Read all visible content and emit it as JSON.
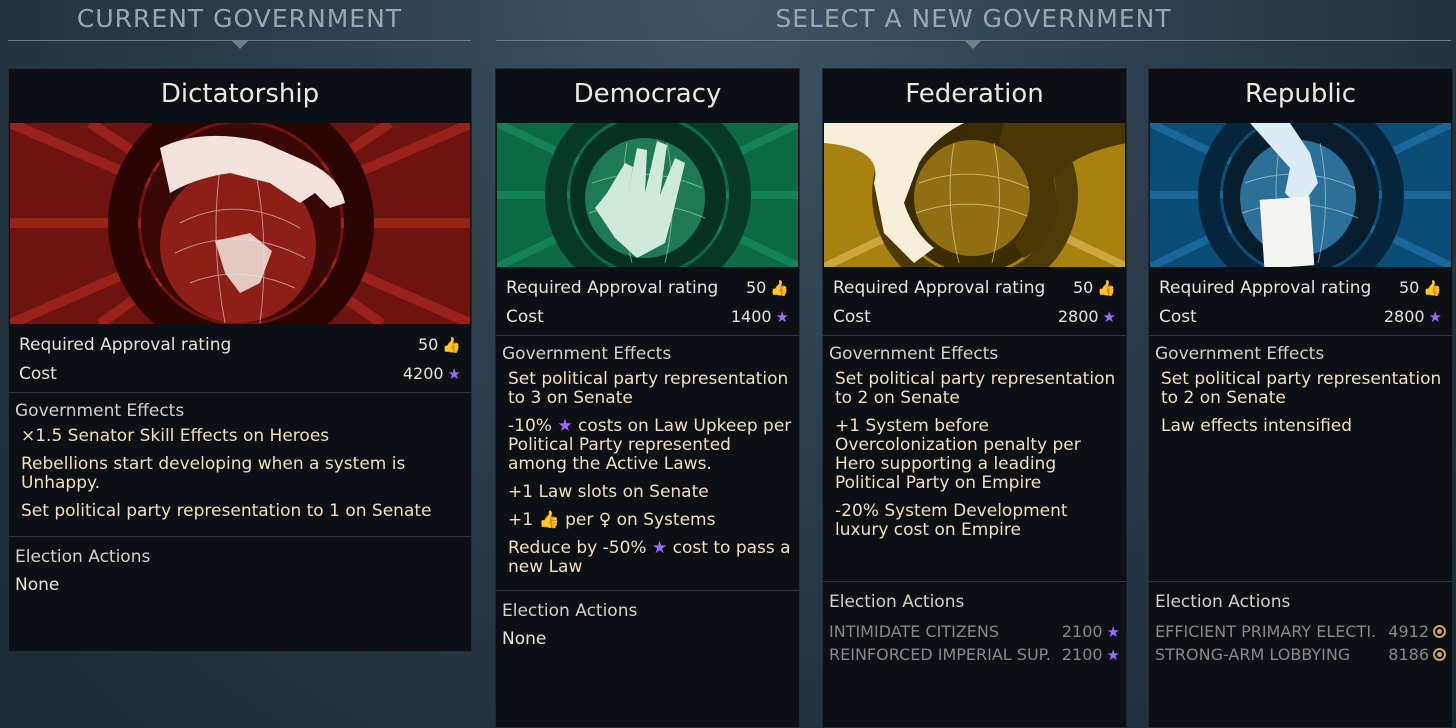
{
  "headers": {
    "current": "CURRENT GOVERNMENT",
    "select": "SELECT A NEW GOVERNMENT"
  },
  "colors": {
    "approval_icon": "#f06ec2",
    "influence_star": "#9b6cff",
    "red_underline": "#d81c1c",
    "effect_text": "#f1dfbf"
  },
  "cards": [
    {
      "name": "Dictatorship",
      "theme": "red",
      "approval_label": "Required Approval rating",
      "approval_value": "50",
      "cost_label": "Cost",
      "cost_value": "4200",
      "effects_label": "Government Effects",
      "effects": [
        "×1.5 Senator Skill Effects on Heroes",
        "Rebellions start developing when a system is Unhappy.",
        "Set political party representation to 1 on Senate"
      ],
      "actions_label": "Election Actions",
      "actions_none": "None"
    },
    {
      "name": "Democracy",
      "theme": "green",
      "approval_label": "Required Approval rating",
      "approval_value": "50",
      "cost_label": "Cost",
      "cost_value": "1400",
      "effects_label": "Government Effects",
      "effects": [
        "Set political party representation to 3 on Senate",
        "-10% ★ costs on Law Upkeep per Political Party represented among the Active Laws.",
        "+1 Law slots on Senate",
        "+1 👍 per ♀ on Systems",
        "Reduce by -50% ★ cost to pass a new Law"
      ],
      "actions_label": "Election Actions",
      "actions_none": "None"
    },
    {
      "name": "Federation",
      "theme": "gold",
      "approval_label": "Required Approval rating",
      "approval_value": "50",
      "cost_label": "Cost",
      "cost_value": "2800",
      "effects_label": "Government Effects",
      "effects": [
        "Set political party representation to 2 on Senate",
        "+1 System before Overcolonization penalty per Hero supporting a leading Political Party on Empire",
        "-20% System Development luxury cost on Empire"
      ],
      "actions_label": "Election Actions",
      "actions": [
        {
          "name": "INTIMIDATE CITIZENS",
          "cost": "2100",
          "currency": "star"
        },
        {
          "name": "REINFORCED IMPERIAL SUP.",
          "cost": "2100",
          "currency": "star"
        }
      ]
    },
    {
      "name": "Republic",
      "theme": "blue",
      "approval_label": "Required Approval rating",
      "approval_value": "50",
      "cost_label": "Cost",
      "cost_value": "2800",
      "effects_label": "Government Effects",
      "effects": [
        "Set political party representation to 2 on Senate",
        "Law effects intensified"
      ],
      "actions_label": "Election Actions",
      "actions": [
        {
          "name": "EFFICIENT PRIMARY ELECTI.",
          "cost": "4912",
          "currency": "dust"
        },
        {
          "name": "STRONG-ARM LOBBYING",
          "cost": "8186",
          "currency": "dust"
        }
      ]
    }
  ]
}
